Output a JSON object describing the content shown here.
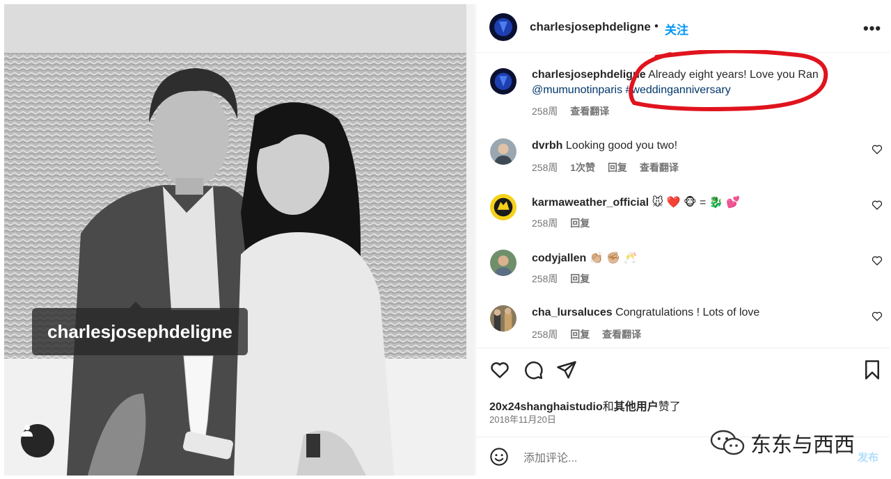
{
  "photo": {
    "tag_username": "charlesjosephdeligne"
  },
  "header": {
    "username": "charlesjosephdeligne",
    "separator": "•",
    "follow_label": "关注",
    "more_label": "•••"
  },
  "caption": {
    "username": "charlesjosephdeligne",
    "text": " Already eight years! Love you Ran",
    "mention": "@mumunotinparis",
    "hashtag": " #weddinganniversary",
    "time": "258周",
    "translate": "查看翻译"
  },
  "comments": [
    {
      "username": "dvrbh",
      "text": " Looking good you two!",
      "time": "258周",
      "likes": "1次赞",
      "reply": "回复",
      "translate": "查看翻译"
    },
    {
      "username": "karmaweather_official",
      "text": " 🐭 ❤️ 🐵 = 🐉 💕",
      "time": "258周",
      "reply": "回复"
    },
    {
      "username": "codyjallen",
      "text": " 👏🏼 ✊🏼 🥂",
      "time": "258周",
      "reply": "回复"
    },
    {
      "username": "cha_lursaluces",
      "text": " Congratulations ! Lots of love",
      "time": "258周",
      "reply": "回复",
      "translate": "查看翻译"
    }
  ],
  "likes": {
    "user": "20x24shanghaistudio",
    "and": "和",
    "others": "其他用户",
    "suffix": "赞了"
  },
  "date": "2018年11月20日",
  "comment_box": {
    "placeholder": "添加评论...",
    "post_label": "发布"
  },
  "watermark": "东东与西西",
  "colors": {
    "link": "#0095f6",
    "mention": "#00376b",
    "annotation": "#e0141e"
  }
}
